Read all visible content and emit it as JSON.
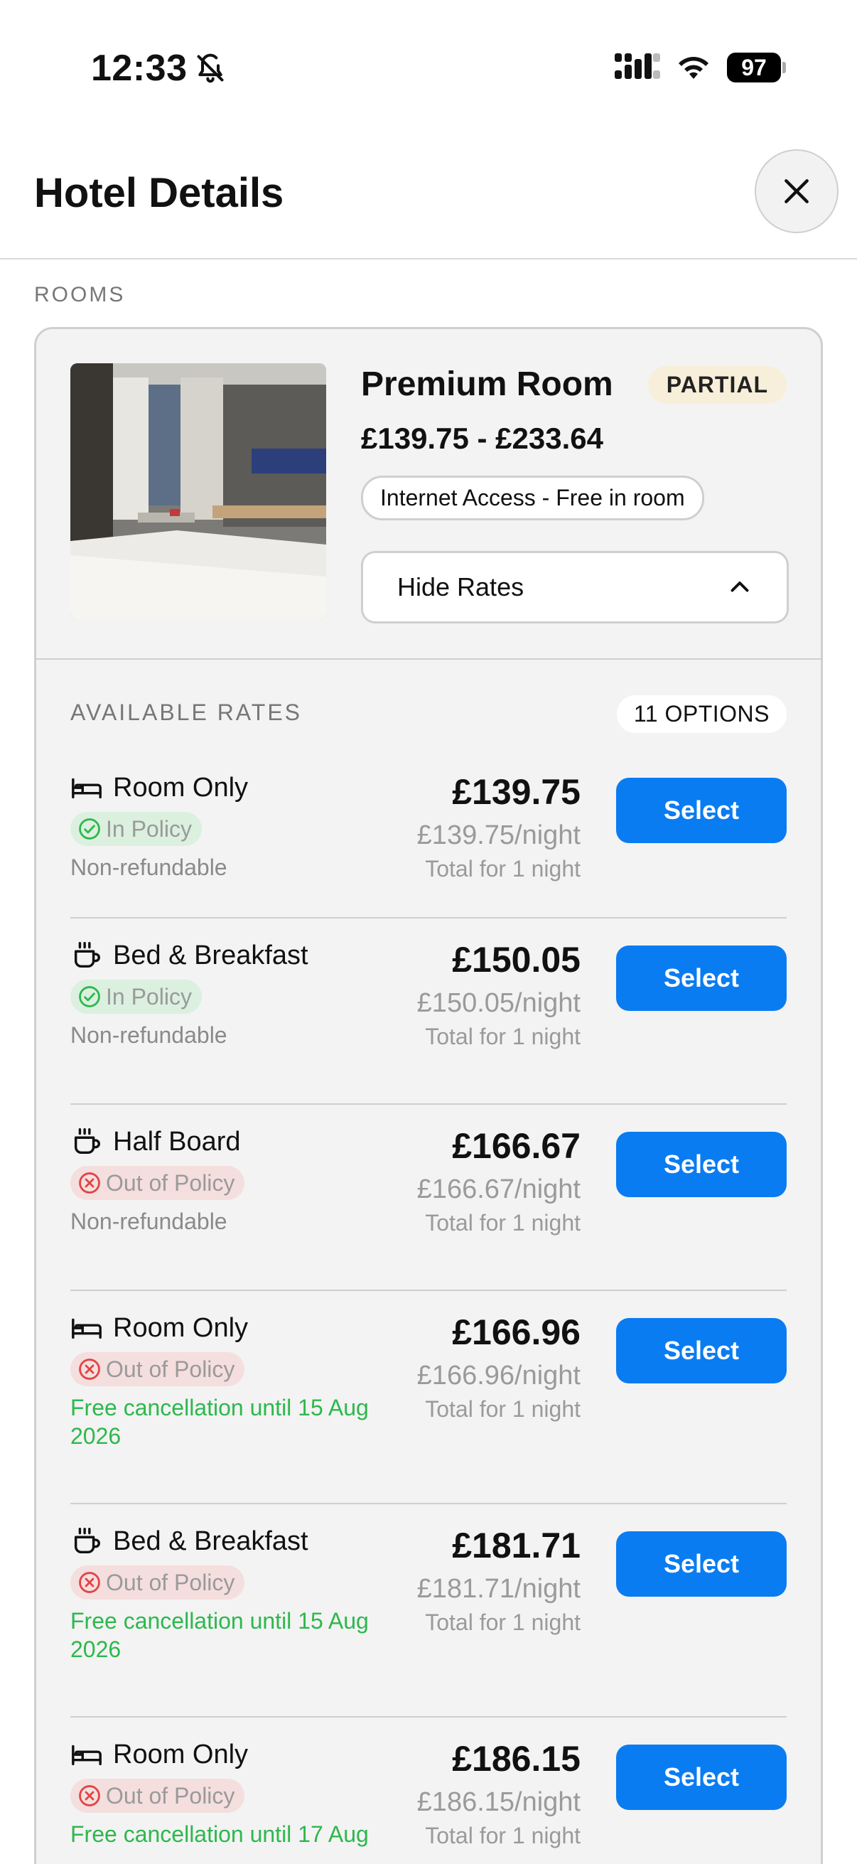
{
  "status_bar": {
    "time": "12:33",
    "battery": "97"
  },
  "header": {
    "title": "Hotel Details"
  },
  "section_label": "ROOMS",
  "room": {
    "name": "Premium Room",
    "badge": "PARTIAL",
    "price_range": "£139.75 - £233.64",
    "amenity": "Internet Access - Free in room",
    "toggle_label": "Hide Rates"
  },
  "rates": {
    "label": "AVAILABLE RATES",
    "count": "11 OPTIONS",
    "items": [
      {
        "board": "Room Only",
        "icon": "bed-icon",
        "policy": "In Policy",
        "policy_status": "in",
        "refund": "Non-refundable",
        "refund_type": "non",
        "total": "£139.75",
        "per_night": "£139.75/night",
        "sub": "Total for 1 night",
        "button": "Select"
      },
      {
        "board": "Bed & Breakfast",
        "icon": "coffee-icon",
        "policy": "In Policy",
        "policy_status": "in",
        "refund": "Non-refundable",
        "refund_type": "non",
        "total": "£150.05",
        "per_night": "£150.05/night",
        "sub": "Total for 1 night",
        "button": "Select"
      },
      {
        "board": "Half Board",
        "icon": "coffee-icon",
        "policy": "Out of Policy",
        "policy_status": "out",
        "refund": "Non-refundable",
        "refund_type": "non",
        "total": "£166.67",
        "per_night": "£166.67/night",
        "sub": "Total for 1 night",
        "button": "Select"
      },
      {
        "board": "Room Only",
        "icon": "bed-icon",
        "policy": "Out of Policy",
        "policy_status": "out",
        "refund": "Free cancellation until 15 Aug 2026",
        "refund_type": "free",
        "total": "£166.96",
        "per_night": "£166.96/night",
        "sub": "Total for 1 night",
        "button": "Select"
      },
      {
        "board": "Bed & Breakfast",
        "icon": "coffee-icon",
        "policy": "Out of Policy",
        "policy_status": "out",
        "refund": "Free cancellation until 15 Aug 2026",
        "refund_type": "free",
        "total": "£181.71",
        "per_night": "£181.71/night",
        "sub": "Total for 1 night",
        "button": "Select"
      },
      {
        "board": "Room Only",
        "icon": "bed-icon",
        "policy": "Out of Policy",
        "policy_status": "out",
        "refund": "Free cancellation until 17 Aug",
        "refund_type": "free",
        "total": "£186.15",
        "per_night": "£186.15/night",
        "sub": "Total for 1 night",
        "button": "Select"
      }
    ]
  },
  "colors": {
    "primary": "#0a7cf2",
    "in_policy_bg": "#dcf0df",
    "out_policy_bg": "#f5dede",
    "free_cancel": "#2db84d",
    "partial_bg": "#f7efd9"
  }
}
